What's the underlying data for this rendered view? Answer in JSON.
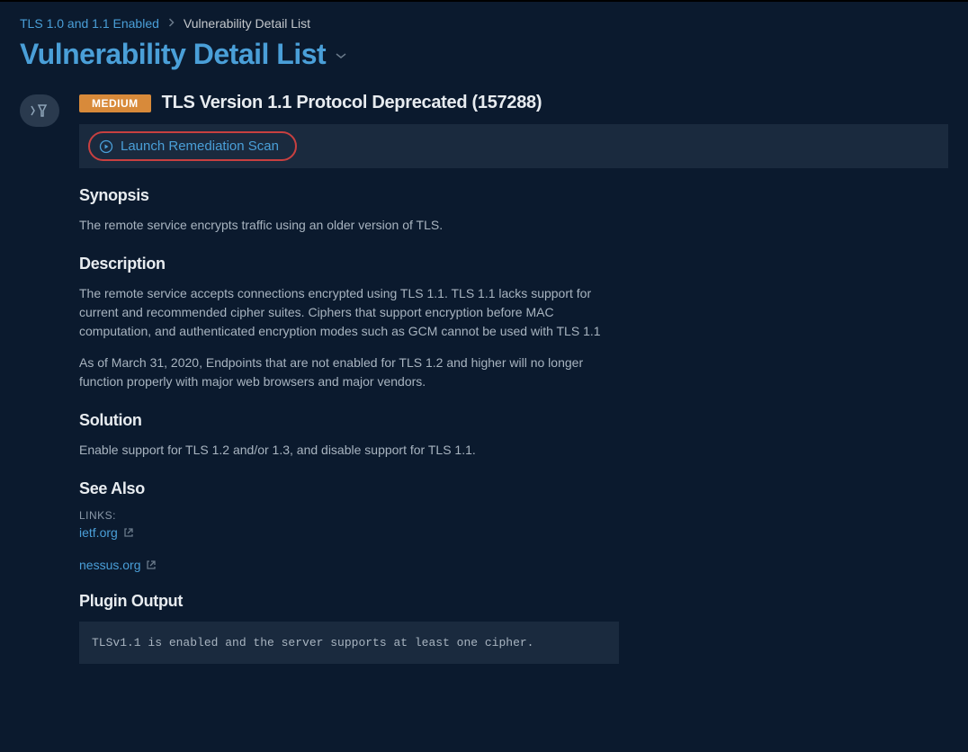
{
  "breadcrumb": {
    "parent": "TLS 1.0 and 1.1 Enabled",
    "current": "Vulnerability Detail List"
  },
  "page_title": "Vulnerability Detail List",
  "severity": "MEDIUM",
  "vuln_title": "TLS Version 1.1 Protocol Deprecated (157288)",
  "launch_button": "Launch Remediation Scan",
  "sections": {
    "synopsis": {
      "heading": "Synopsis",
      "text": "The remote service encrypts traffic using an older version of TLS."
    },
    "description": {
      "heading": "Description",
      "p1": "The remote service accepts connections encrypted using TLS 1.1. TLS 1.1 lacks support for current and recommended cipher suites. Ciphers that support encryption before MAC computation, and authenticated encryption modes such as GCM cannot be used with TLS 1.1",
      "p2": "As of March 31, 2020, Endpoints that are not enabled for TLS 1.2 and higher will no longer function properly with major web browsers and major vendors."
    },
    "solution": {
      "heading": "Solution",
      "text": "Enable support for TLS 1.2 and/or 1.3, and disable support for TLS 1.1."
    },
    "see_also": {
      "heading": "See Also",
      "links_label": "LINKS:",
      "links": [
        "ietf.org",
        "nessus.org"
      ]
    },
    "plugin_output": {
      "heading": "Plugin Output",
      "text": "TLSv1.1 is enabled and the server supports at least one cipher."
    }
  }
}
